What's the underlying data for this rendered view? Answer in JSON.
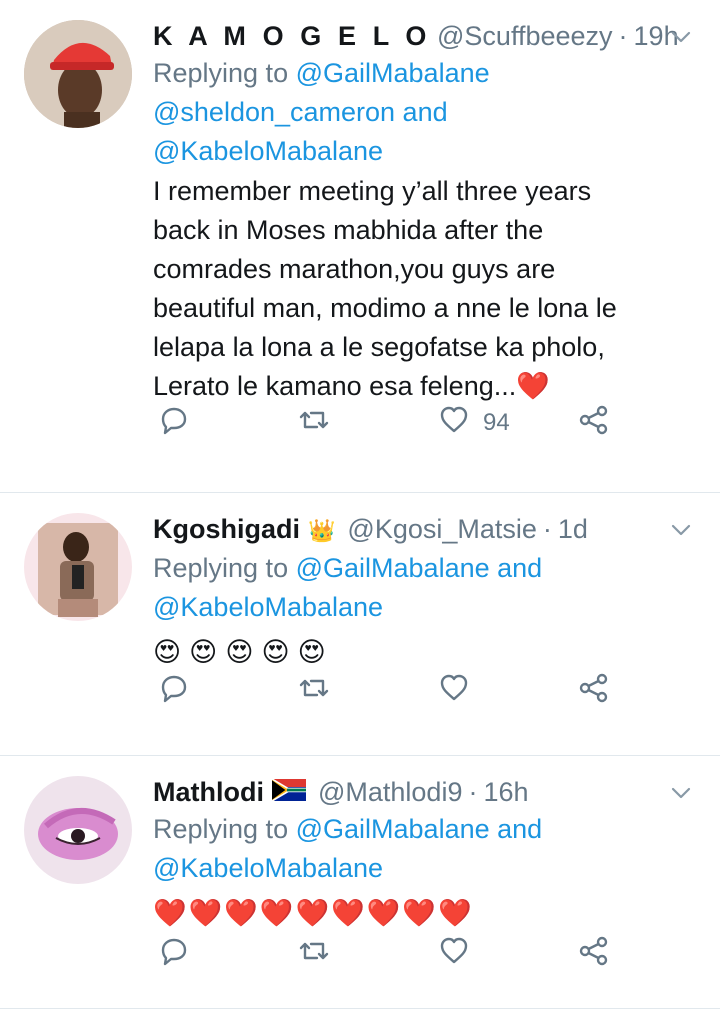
{
  "tweets": [
    {
      "name": "K A M O G E L O",
      "handle": "@Scuffbeeezy",
      "dot": "·",
      "time": "19h",
      "reply_prefix": "Replying to",
      "mentions_line1": "@GailMabalane",
      "mentions_line2": "@sheldon_cameron and",
      "mentions_line3": "@KabeloMabalane",
      "body_lines": [
        "I remember meeting y’all three years",
        "back in Moses mabhida after the",
        "comrades marathon,you guys are",
        "beautiful man, modimo a nne le lona le",
        "lelapa la lona a le segofatse ka pholo,",
        "Lerato le kamano esa feleng..."
      ],
      "like_count": "94"
    },
    {
      "name": "Kgoshigadi",
      "badge": "👑",
      "handle": "@Kgosi_Matsie",
      "dot": "·",
      "time": "1d",
      "reply_prefix": "Replying to",
      "mentions_line1": "@GailMabalane and",
      "mentions_line2": "@KabeloMabalane",
      "emojis": [
        "😍",
        "😍",
        "😍",
        "😍",
        "😍"
      ]
    },
    {
      "name": "Mathlodi",
      "badge": "🇿🇦",
      "handle": "@Mathlodi9",
      "dot": "·",
      "time": "16h",
      "reply_prefix": "Replying to",
      "mentions_line1": "@GailMabalane and",
      "mentions_line2": "@KabeloMabalane",
      "emojis": [
        "❤️",
        "❤️",
        "❤️",
        "❤️",
        "❤️",
        "❤️",
        "❤️",
        "❤️",
        "❤️"
      ]
    }
  ],
  "colors": {
    "text": "#14171a",
    "secondary": "#657786",
    "link": "#1b95e0",
    "divider": "#e1e8ed",
    "heart": "#e0245e"
  },
  "icons": {
    "reply": "reply-icon",
    "retweet": "retweet-icon",
    "like": "like-icon",
    "share": "share-icon",
    "more": "chevron-down-icon"
  }
}
